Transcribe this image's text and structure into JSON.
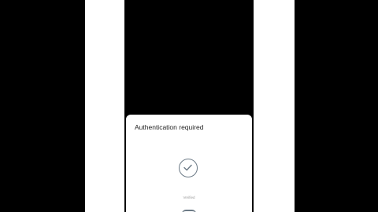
{
  "auth_dialog": {
    "title": "Authentication required",
    "status": "Verified",
    "check_icon": "checkmark-icon",
    "action_icon": "fingerprint-icon"
  },
  "colors": {
    "background": "#000000",
    "panel": "#ffffff",
    "icon_stroke": "#6c7a86"
  }
}
